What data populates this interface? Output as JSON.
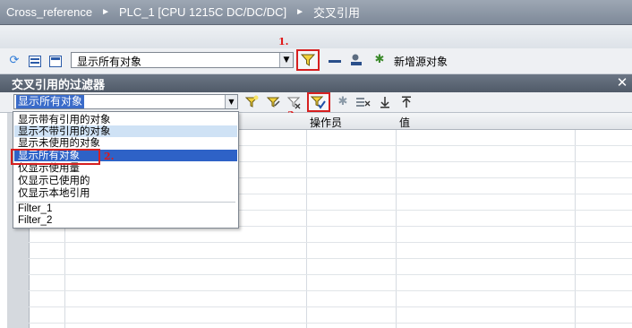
{
  "breadcrumb": {
    "items": [
      "Cross_reference",
      "PLC_1 [CPU 1215C DC/DC/DC]",
      "交叉引用"
    ],
    "separator": "►"
  },
  "toolbar": {
    "view_select_value": "显示所有对象",
    "new_source_label": "新增源对象",
    "step1": "1."
  },
  "filter_panel": {
    "title": "交叉引用的过滤器",
    "filter_select_value": "显示所有对象",
    "step3": "3.",
    "close_glyph": "✕"
  },
  "dropdown": {
    "items": [
      "显示带有引用的对象",
      "显示不带引用的对象",
      "显示未使用的对象",
      "显示所有对象",
      "仅显示使用量",
      "仅显示已使用的",
      "仅显示本地引用"
    ],
    "user_filters": [
      "Filter_1",
      "Filter_2"
    ],
    "highlighted_index": 1,
    "selected_index": 3,
    "step2": "2."
  },
  "table": {
    "columns": [
      "操作员",
      "值"
    ]
  },
  "colors": {
    "title_bar": "#8a94a2",
    "panel_header": "#5a6472",
    "selection": "#2e62c7",
    "hover": "#cfe2f5",
    "annotation_red": "#d62020"
  }
}
